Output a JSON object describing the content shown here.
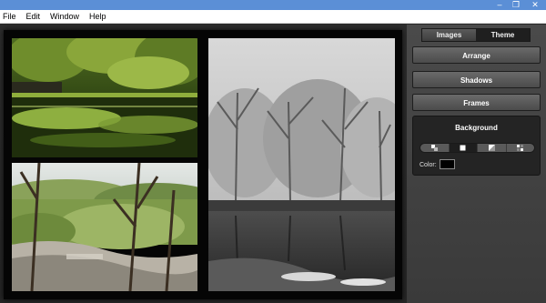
{
  "window": {
    "buttons": {
      "minimize": "–",
      "maximize": "❐",
      "close": "✕"
    }
  },
  "menu": {
    "items": [
      "File",
      "Edit",
      "Window",
      "Help"
    ]
  },
  "collage": {
    "background_color": "#050505",
    "photos": [
      {
        "name": "forest-river-photo"
      },
      {
        "name": "winter-lake-photo"
      },
      {
        "name": "spring-river-photo"
      }
    ]
  },
  "panel": {
    "tabs": [
      {
        "label": "Images",
        "active": false
      },
      {
        "label": "Theme",
        "active": true
      }
    ],
    "buttons": {
      "arrange": "Arrange",
      "shadows": "Shadows",
      "frames": "Frames"
    },
    "background": {
      "title": "Background",
      "options": [
        "gradient-icon",
        "solid-icon",
        "fade-icon",
        "texture-icon"
      ],
      "selected_option": "solid-icon",
      "color_label": "Color:",
      "color_value": "#000000"
    }
  },
  "colors": {
    "titlebar": "#5b8fd6",
    "panel": "#4a4a4a",
    "canvas": "#2a2a2a"
  }
}
